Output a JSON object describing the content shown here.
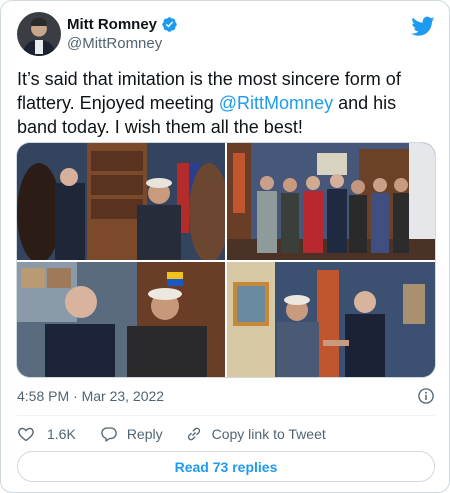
{
  "author": {
    "display_name": "Mitt Romney",
    "handle": "@MittRomney",
    "verified_icon": "verified-badge-icon",
    "brand_icon": "twitter-bird-icon"
  },
  "tweet": {
    "text_before": "It’s said that imitation is the most sincere form of flattery. Enjoyed meeting ",
    "mention": "@RittMomney",
    "text_after": " and his band today. I wish them all the best!"
  },
  "media": {
    "photos": [
      {
        "icon": "photo-1"
      },
      {
        "icon": "photo-2"
      },
      {
        "icon": "photo-3"
      },
      {
        "icon": "photo-4"
      }
    ]
  },
  "meta": {
    "timestamp": "4:58 PM · Mar 23, 2022",
    "info_icon": "info-icon"
  },
  "actions": {
    "like_count": "1.6K",
    "reply_label": "Reply",
    "copy_link_label": "Copy link to Tweet"
  },
  "read_replies_label": "Read 73 replies",
  "colors": {
    "accent": "#1d9bf0",
    "text_primary": "#0f1419",
    "text_secondary": "#536471",
    "border": "#cfd9de"
  }
}
